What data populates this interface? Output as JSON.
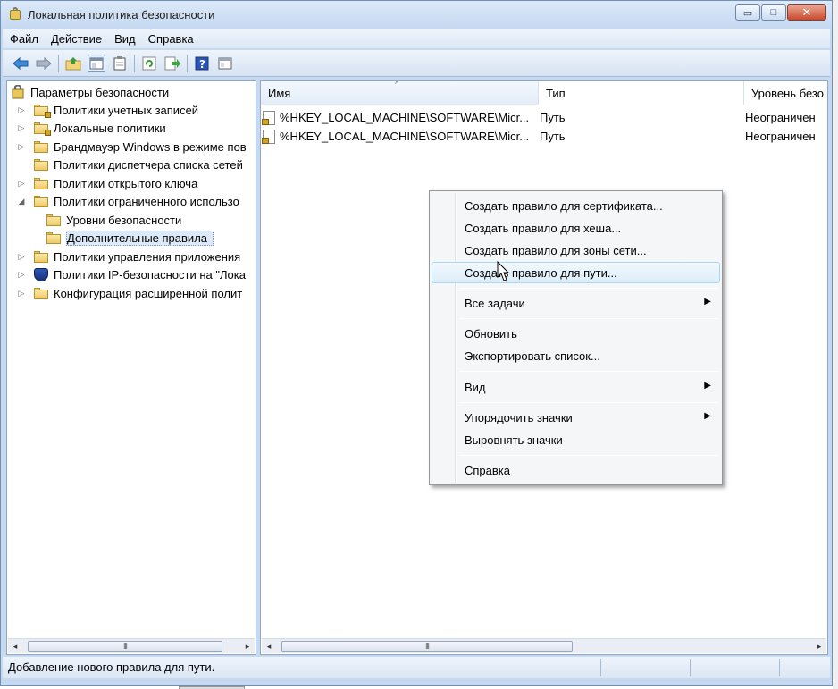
{
  "window": {
    "title": "Локальная политика безопасности",
    "buttons": {
      "minimize": "▭",
      "maximize": "□",
      "close": "✕"
    }
  },
  "menu": [
    "Файл",
    "Действие",
    "Вид",
    "Справка"
  ],
  "toolbar": {
    "icons": [
      "back-arrow-icon",
      "forward-arrow-icon",
      "up-folder-icon",
      "show-tree-icon",
      "properties-icon",
      "refresh-icon",
      "export-icon",
      "help-icon",
      "console-icon"
    ]
  },
  "tree": {
    "root": "Параметры безопасности",
    "items": [
      {
        "label": "Политики учетных записей",
        "expander": "▷",
        "lock": true
      },
      {
        "label": "Локальные политики",
        "expander": "▷",
        "lock": true
      },
      {
        "label": "Брандмауэр Windows в режиме пов",
        "expander": "▷",
        "lock": false
      },
      {
        "label": "Политики диспетчера списка сетей",
        "expander": "",
        "lock": false
      },
      {
        "label": "Политики открытого ключа",
        "expander": "▷",
        "lock": false
      },
      {
        "label": "Политики ограниченного использо",
        "expander": "◢",
        "lock": false
      },
      {
        "label": "Уровни безопасности",
        "expander": "",
        "lock": false,
        "child": true
      },
      {
        "label": "Дополнительные правила",
        "expander": "",
        "lock": false,
        "child": true,
        "selected": true
      },
      {
        "label": "Политики управления приложения",
        "expander": "▷",
        "lock": false
      },
      {
        "label": "Политики IP-безопасности на \"Лока",
        "expander": "▷",
        "lock": false,
        "shield": true
      },
      {
        "label": "Конфигурация расширенной полит",
        "expander": "▷",
        "lock": false
      }
    ]
  },
  "list": {
    "columns": [
      "Имя",
      "Тип",
      "Уровень безо"
    ],
    "rows": [
      {
        "name": "%HKEY_LOCAL_MACHINE\\SOFTWARE\\Micr...",
        "type": "Путь",
        "level": "Неограничен"
      },
      {
        "name": "%HKEY_LOCAL_MACHINE\\SOFTWARE\\Micr...",
        "type": "Путь",
        "level": "Неограничен"
      }
    ]
  },
  "context_menu": {
    "items": [
      "Создать правило для сертификата...",
      "Создать правило для хеша...",
      "Создать правило для зоны сети...",
      "Создать правило для пути...",
      "Все задачи",
      "Обновить",
      "Экспортировать список...",
      "Вид",
      "Упорядочить значки",
      "Выровнять значки",
      "Справка"
    ],
    "submenu_arrow": "▶"
  },
  "scroll": {
    "grip": "III",
    "left": "◂",
    "right": "▸"
  },
  "status": {
    "text": "Добавление нового правила для пути."
  }
}
